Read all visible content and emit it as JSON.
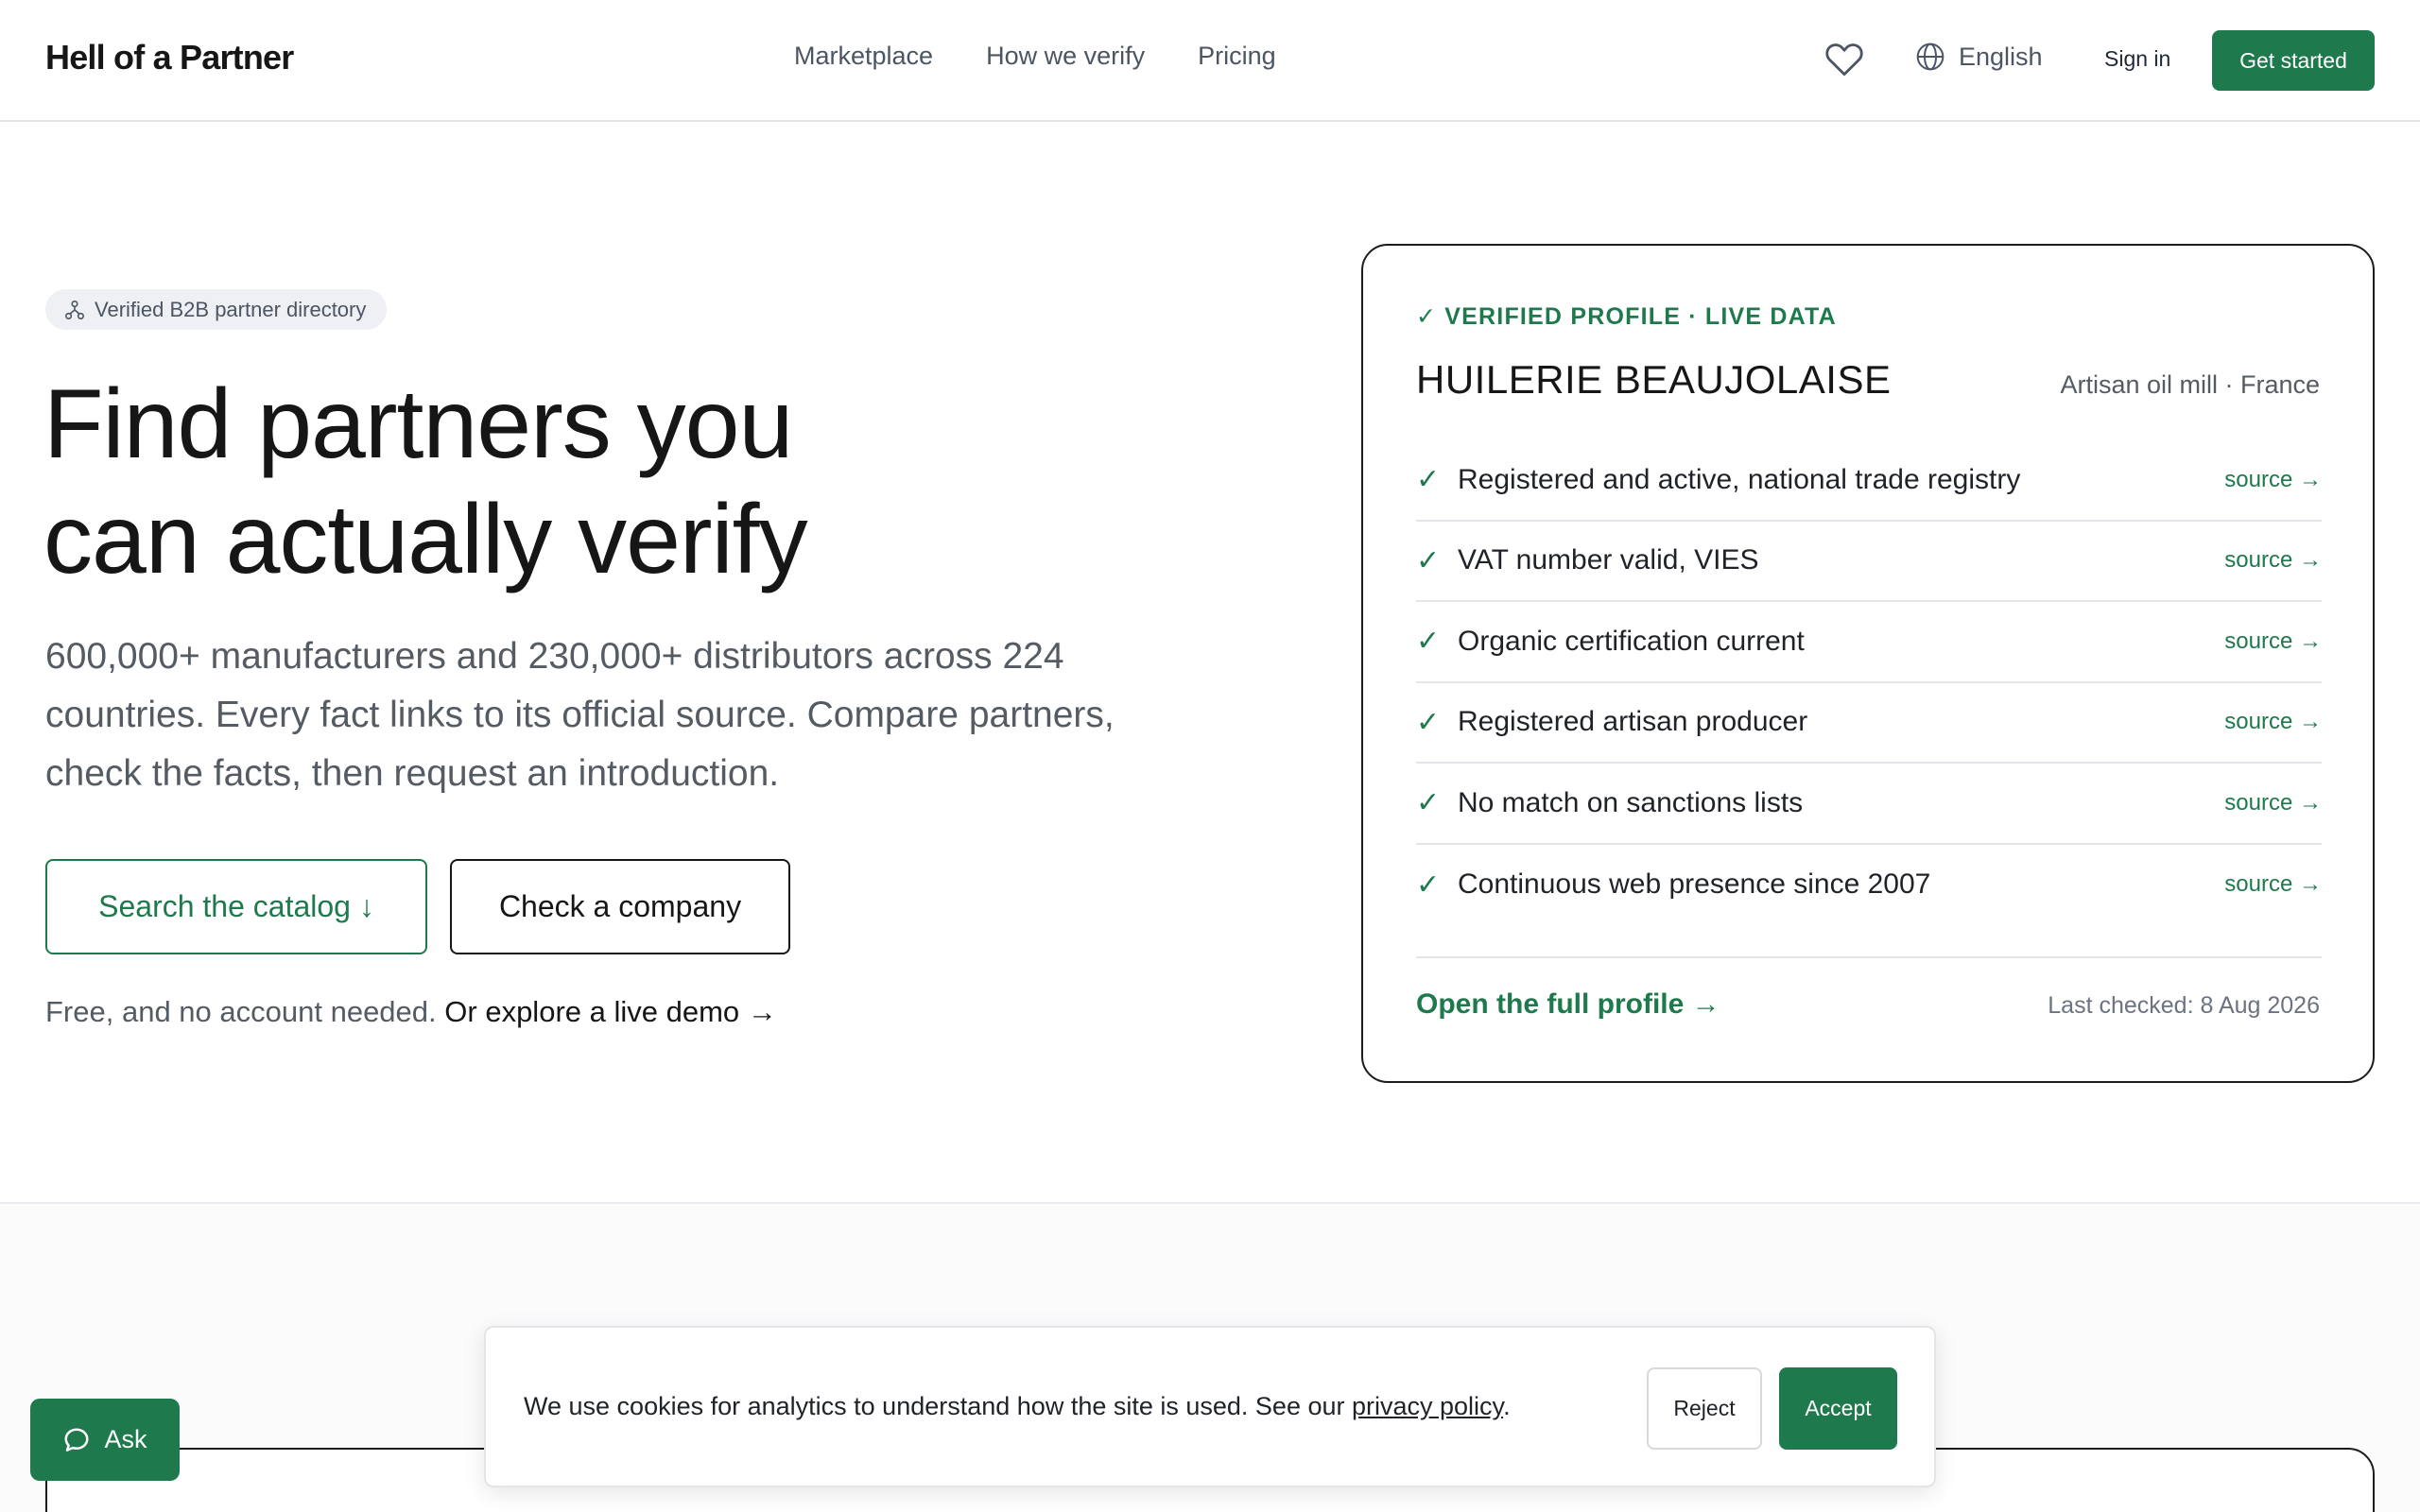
{
  "header": {
    "brand": "Hell of a Partner",
    "nav": [
      "Marketplace",
      "How we verify",
      "Pricing"
    ],
    "language": "English",
    "sign_in": "Sign in",
    "get_started": "Get started"
  },
  "hero": {
    "pill": "Verified B2B partner directory",
    "title_line1": "Find partners you",
    "title_line2": "can actually verify",
    "subtitle": "600,000+ manufacturers and 230,000+ distributors across 224 countries. Every fact links to its official source. Compare partners, check the facts, then request an introduction.",
    "search_button": "Search the catalog ↓",
    "check_button": "Check a company",
    "free_text": "Free, and no account needed.",
    "demo_link": "Or explore a live demo →"
  },
  "card": {
    "badge": "✓ VERIFIED PROFILE · LIVE DATA",
    "name": "HUILERIE BEAUJOLAISE",
    "meta": "Artisan oil mill · France",
    "checks": [
      {
        "text": "Registered and active, national trade registry",
        "link": "source →"
      },
      {
        "text": "VAT number valid, VIES",
        "link": "source →"
      },
      {
        "text": "Organic certification current",
        "link": "source →"
      },
      {
        "text": "Registered artisan producer",
        "link": "source →"
      },
      {
        "text": "No match on sanctions lists",
        "link": "source →"
      },
      {
        "text": "Continuous web presence since 2007",
        "link": "source →"
      }
    ],
    "check_mark": "✓",
    "open_profile": "Open the full profile →",
    "last_checked": "Last checked: 8 Aug 2026"
  },
  "cookie": {
    "text": "We use cookies for analytics to understand how the site is used. See our",
    "link": "privacy policy",
    "period": ".",
    "reject": "Reject",
    "accept": "Accept"
  },
  "ask": {
    "label": "Ask"
  },
  "colors": {
    "accent": "#1e7a4c",
    "text": "#161616",
    "muted": "#555b63",
    "border": "#e3e5e8"
  }
}
